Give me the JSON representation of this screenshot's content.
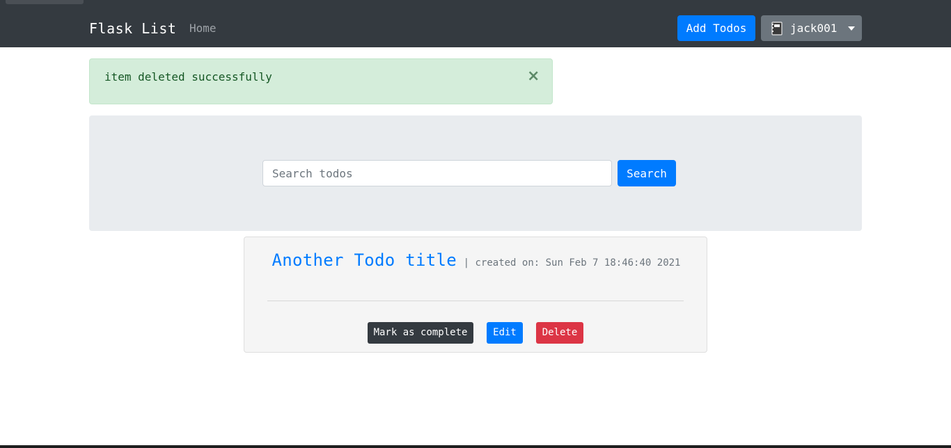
{
  "navbar": {
    "brand": "Flask List",
    "home_link": "Home",
    "add_button": "Add Todos",
    "user_button": "jack001",
    "user_icon": "notebook-icon"
  },
  "alert": {
    "message": "item deleted successfully",
    "close_symbol": "×"
  },
  "search": {
    "placeholder": "Search todos",
    "value": "",
    "button_label": "Search"
  },
  "todos": [
    {
      "title": "Another Todo title",
      "meta": "| created on: Sun Feb 7 18:46:40 2021",
      "actions": {
        "complete_label": "Mark as complete",
        "edit_label": "Edit",
        "delete_label": "Delete"
      }
    }
  ],
  "colors": {
    "navbar_bg": "#343a40",
    "primary": "#007bff",
    "secondary": "#6c757d",
    "danger": "#dc3545",
    "success_bg": "#d4edda",
    "jumbotron_bg": "#e9ecef"
  }
}
